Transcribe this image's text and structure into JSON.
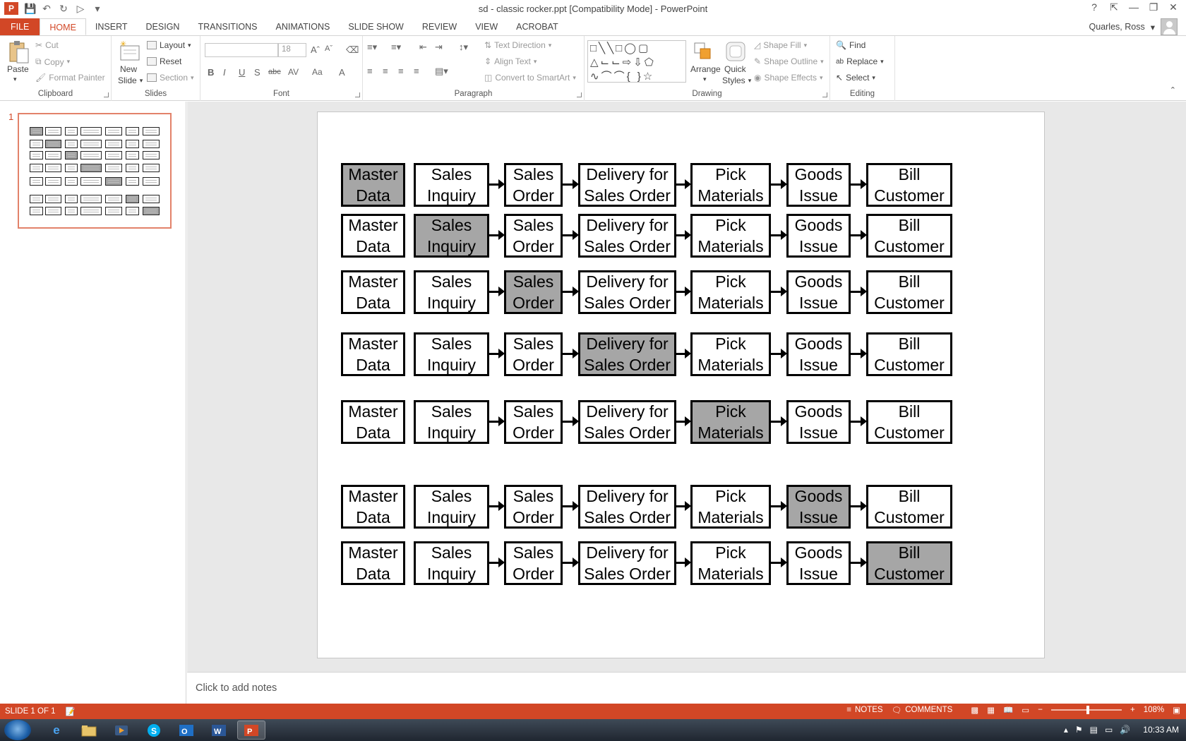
{
  "window": {
    "title": "sd - classic rocker.ppt [Compatibility Mode] - PowerPoint",
    "help": "?",
    "ribbon_display_icon": "ribbon-display-icon",
    "minimize": "—",
    "restore": "❐",
    "close": "✕"
  },
  "qat": {
    "save_icon": "save-icon",
    "undo_icon": "undo-icon",
    "redo_icon": "redo-icon",
    "present_icon": "present-icon"
  },
  "tabs": [
    "FILE",
    "HOME",
    "INSERT",
    "DESIGN",
    "TRANSITIONS",
    "ANIMATIONS",
    "SLIDE SHOW",
    "REVIEW",
    "VIEW",
    "ACROBAT"
  ],
  "active_tab": "HOME",
  "user": {
    "name": "Quarles, Ross"
  },
  "ribbon": {
    "clipboard": {
      "label": "Clipboard",
      "paste": "Paste",
      "cut": "Cut",
      "copy": "Copy",
      "format_painter": "Format Painter"
    },
    "slides": {
      "label": "Slides",
      "new_slide": "New",
      "new_slide_2": "Slide",
      "layout": "Layout",
      "reset": "Reset",
      "section": "Section"
    },
    "font": {
      "label": "Font",
      "font_name": "",
      "font_size": "18",
      "bold": "B",
      "italic": "I",
      "underline": "U",
      "shadow": "S",
      "strike": "abc",
      "spacing": "AV",
      "case": "Aa",
      "color": "A"
    },
    "paragraph": {
      "label": "Paragraph",
      "text_direction": "Text Direction",
      "align_text": "Align Text",
      "convert_smartart": "Convert to SmartArt"
    },
    "drawing": {
      "label": "Drawing",
      "arrange": "Arrange",
      "quick_styles": "Quick",
      "quick_styles_2": "Styles",
      "shape_fill": "Shape Fill",
      "shape_outline": "Shape Outline",
      "shape_effects": "Shape Effects"
    },
    "editing": {
      "label": "Editing",
      "find": "Find",
      "replace": "Replace",
      "select": "Select"
    }
  },
  "thumbnail": {
    "number": "1"
  },
  "slide": {
    "steps": [
      "Master Data",
      "Sales Inquiry",
      "Sales Order",
      "Delivery for Sales Order",
      "Pick Materials",
      "Goods Issue",
      "Bill Customer"
    ],
    "rows": [
      {
        "cells": [
          [
            "Master",
            "Data"
          ],
          [
            "Sales",
            "Inquiry"
          ],
          [
            "Sales",
            "Order"
          ],
          [
            "Delivery for",
            "Sales Order"
          ],
          [
            "Pick",
            "Materials"
          ],
          [
            "Goods",
            "Issue"
          ],
          [
            "Bill",
            "Customer"
          ]
        ],
        "highlight": 0
      },
      {
        "cells": [
          [
            "Master",
            "Data"
          ],
          [
            "Sales",
            "Inquiry"
          ],
          [
            "Sales",
            "Order"
          ],
          [
            "Delivery for",
            "Sales Order"
          ],
          [
            "Pick",
            "Materials"
          ],
          [
            "Goods",
            "Issue"
          ],
          [
            "Bill",
            "Customer"
          ]
        ],
        "highlight": 1
      },
      {
        "cells": [
          [
            "Master",
            "Data"
          ],
          [
            "Sales",
            "Inquiry"
          ],
          [
            "Sales",
            "Order"
          ],
          [
            "Delivery for",
            "Sales Order"
          ],
          [
            "Pick",
            "Materials"
          ],
          [
            "Goods",
            "Issue"
          ],
          [
            "Bill",
            "Customer"
          ]
        ],
        "highlight": 2
      },
      {
        "cells": [
          [
            "Master",
            "Data"
          ],
          [
            "Sales",
            "Inquiry"
          ],
          [
            "Sales",
            "Order"
          ],
          [
            "Delivery for",
            "Sales Order"
          ],
          [
            "Pick",
            "Materials"
          ],
          [
            "Goods",
            "Issue"
          ],
          [
            "Bill",
            "Customer"
          ]
        ],
        "highlight": 3
      },
      {
        "cells": [
          [
            "Master",
            "Data"
          ],
          [
            "Sales",
            "Inquiry"
          ],
          [
            "Sales",
            "Order"
          ],
          [
            "Delivery for",
            "Sales Order"
          ],
          [
            "Pick",
            "Materials"
          ],
          [
            "Goods",
            "Issue"
          ],
          [
            "Bill",
            "Customer"
          ]
        ],
        "highlight": 4
      },
      {
        "cells": [
          [
            "Master",
            "Data"
          ],
          [
            "Sales",
            "Inquiry"
          ],
          [
            "Sales",
            "Order"
          ],
          [
            "Delivery for",
            "Sales Order"
          ],
          [
            "Pick",
            "Materials"
          ],
          [
            "Goods",
            "Issue"
          ],
          [
            "Bill",
            "Customer"
          ]
        ],
        "highlight": 5
      },
      {
        "cells": [
          [
            "Master",
            "Data"
          ],
          [
            "Sales",
            "Inquiry"
          ],
          [
            "Sales",
            "Order"
          ],
          [
            "Delivery for",
            "Sales Order"
          ],
          [
            "Pick",
            "Materials"
          ],
          [
            "Goods",
            "Issue"
          ],
          [
            "Bill",
            "Customer"
          ]
        ],
        "highlight": 6
      }
    ],
    "highlight_color": "#a6a6a6"
  },
  "notes": {
    "placeholder": "Click to add notes"
  },
  "status": {
    "slide": "SLIDE 1 OF 1",
    "notes": "NOTES",
    "comments": "COMMENTS",
    "zoom": "108%"
  },
  "taskbar": {
    "clock": "10:33 AM",
    "apps": [
      "ie-icon",
      "explorer-icon",
      "media-icon",
      "skype-icon",
      "outlook-icon",
      "word-icon",
      "powerpoint-icon"
    ]
  },
  "colors": {
    "accent": "#d24726"
  }
}
